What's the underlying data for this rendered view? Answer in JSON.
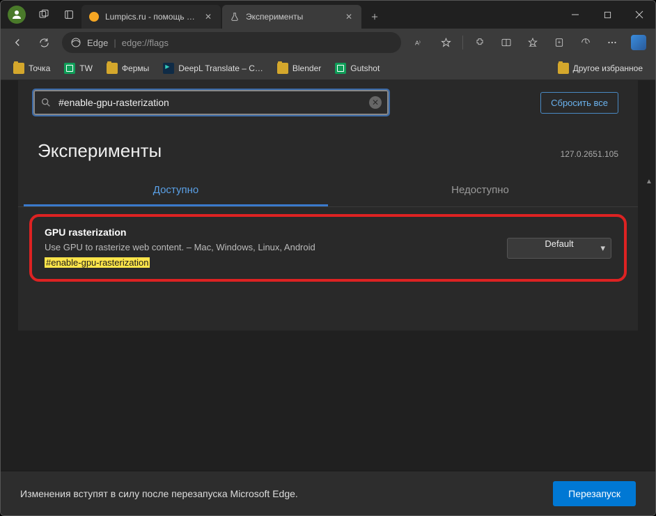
{
  "titlebar": {
    "tabs": [
      {
        "label": "Lumpics.ru - помощь с компью…",
        "favicon": "lumpics"
      },
      {
        "label": "Эксперименты",
        "favicon": "flask"
      }
    ]
  },
  "toolbar": {
    "browser_label": "Edge",
    "url": "edge://flags"
  },
  "bookmarks": {
    "items": [
      {
        "label": "Точка",
        "icon": "folder"
      },
      {
        "label": "TW",
        "icon": "sheets"
      },
      {
        "label": "Фермы",
        "icon": "folder"
      },
      {
        "label": "DeepL Translate – С…",
        "icon": "deepl"
      },
      {
        "label": "Blender",
        "icon": "folder"
      },
      {
        "label": "Gutshot",
        "icon": "sheets"
      }
    ],
    "other": "Другое избранное"
  },
  "flags": {
    "search_value": "#enable-gpu-rasterization",
    "reset_label": "Сбросить все",
    "page_title": "Эксперименты",
    "version": "127.0.2651.105",
    "tab_available": "Доступно",
    "tab_unavailable": "Недоступно",
    "item": {
      "title": "GPU rasterization",
      "description": "Use GPU to rasterize web content. – Mac, Windows, Linux, Android",
      "hash": "#enable-gpu-rasterization",
      "select_value": "Default"
    }
  },
  "footer": {
    "message": "Изменения вступят в силу после перезапуска Microsoft Edge.",
    "restart_label": "Перезапуск"
  }
}
